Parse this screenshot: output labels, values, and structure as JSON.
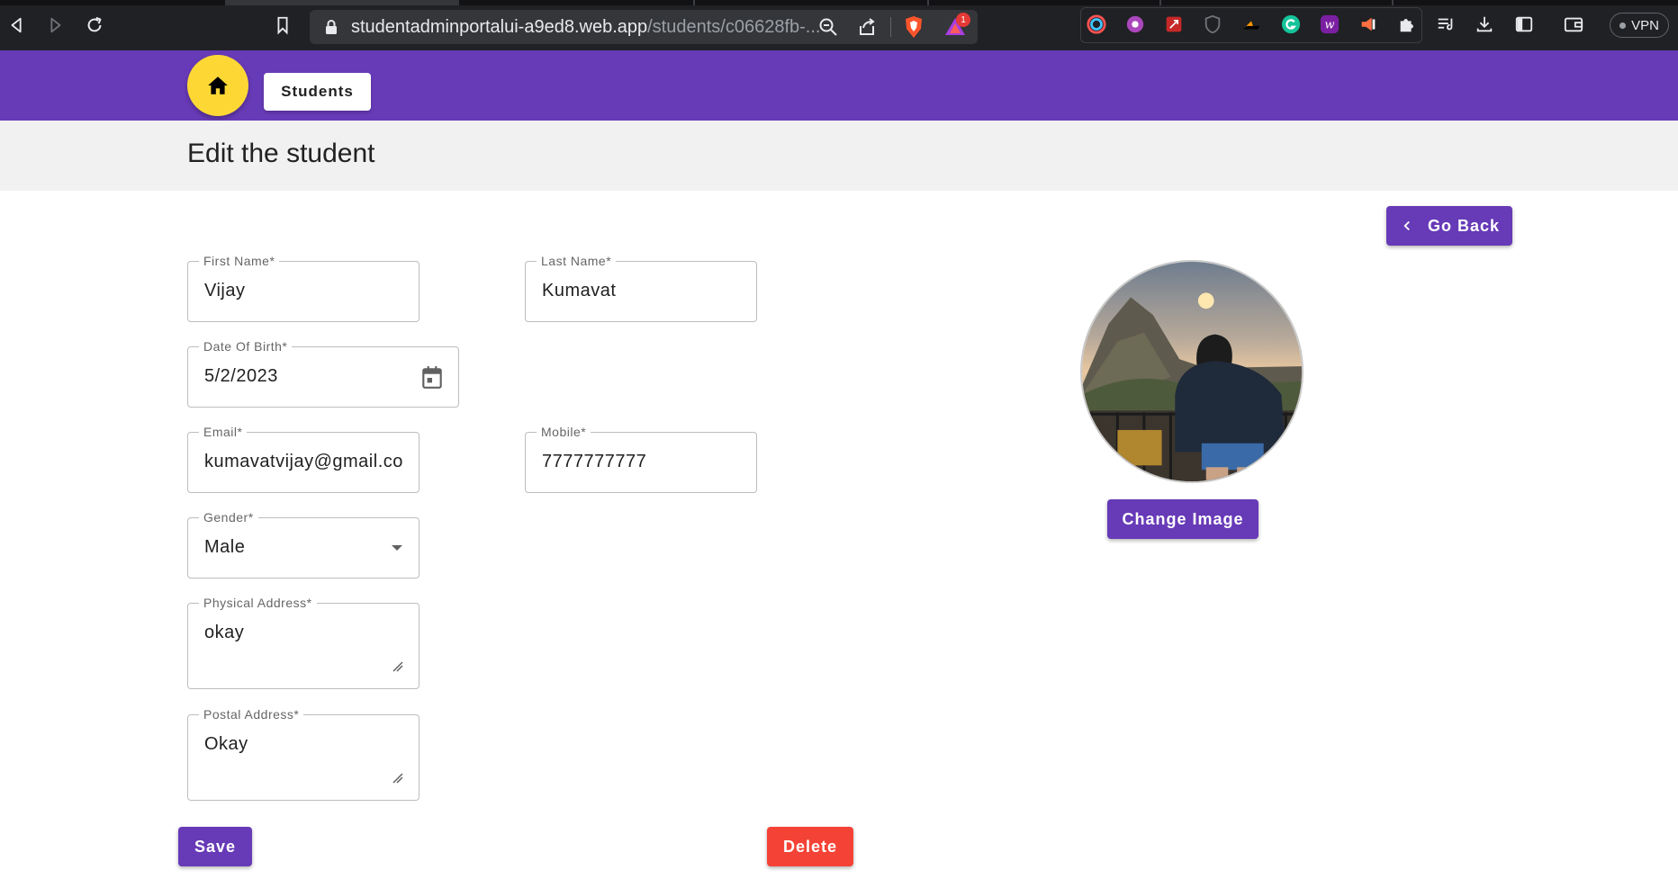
{
  "browser": {
    "url_host": "studentadminportalui-a9ed8.web.app",
    "url_path": "/students/c06628fb-...",
    "notification_count": "1",
    "vpn_label": "VPN"
  },
  "header": {
    "students_label": "Students"
  },
  "page": {
    "title": "Edit the student",
    "go_back_label": "Go Back"
  },
  "form": {
    "first_name": {
      "label": "First Name*",
      "value": "Vijay"
    },
    "last_name": {
      "label": "Last Name*",
      "value": "Kumavat"
    },
    "dob": {
      "label": "Date Of Birth*",
      "value": "5/2/2023"
    },
    "email": {
      "label": "Email*",
      "value": "kumavatvijay@gmail.com"
    },
    "mobile": {
      "label": "Mobile*",
      "value": "7777777777"
    },
    "gender": {
      "label": "Gender*",
      "value": "Male"
    },
    "physical_address": {
      "label": "Physical Address*",
      "value": "okay"
    },
    "postal_address": {
      "label": "Postal Address*",
      "value": "Okay"
    }
  },
  "actions": {
    "save_label": "Save",
    "delete_label": "Delete",
    "change_image_label": "Change Image"
  },
  "colors": {
    "primary": "#673ab7",
    "accent_home": "#fdd835",
    "danger": "#f44336",
    "title_bar_bg": "#f1f1f1"
  }
}
